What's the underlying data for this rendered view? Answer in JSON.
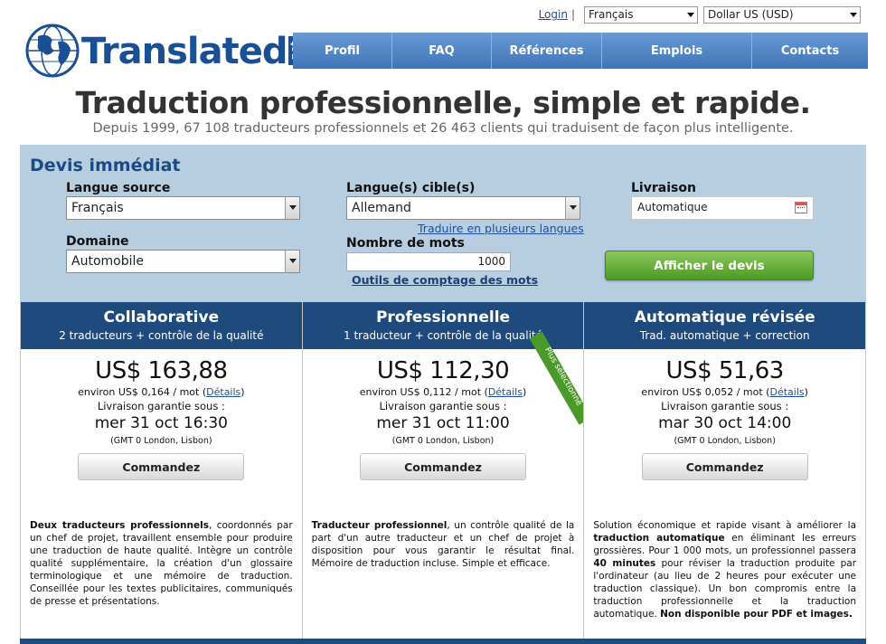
{
  "topbar": {
    "login": "Login",
    "separator": "|",
    "language": "Français",
    "currency": "Dollar US (USD)"
  },
  "logo": {
    "name": "Translated",
    "suffix": "net"
  },
  "nav": [
    "Profil",
    "FAQ",
    "Références",
    "Emplois",
    "Contacts"
  ],
  "headline": "Traduction professionnelle, simple et rapide.",
  "subline": "Depuis 1999, 67 108 traducteurs professionnels et 26 463 clients qui traduisent de façon plus intelligente.",
  "quote": {
    "title": "Devis immédiat",
    "source_label": "Langue source",
    "source_value": "Français",
    "target_label": "Langue(s) cible(s)",
    "target_value": "Allemand",
    "multi_link": "Traduire en plusieurs langues",
    "delivery_label": "Livraison",
    "delivery_value": "Automatique",
    "domain_label": "Domaine",
    "domain_value": "Automobile",
    "words_label": "Nombre de mots",
    "words_value": "1000",
    "count_link": "Outils de comptage des mots",
    "submit": "Afficher le devis"
  },
  "plans": [
    {
      "title": "Collaborative",
      "subtitle": "2 traducteurs + contrôle de la qualité",
      "price": "US$ 163,88",
      "per_word": "environ US$ 0,164 / mot (",
      "details": "Détails",
      "per_close": ")",
      "guarantee": "Livraison garantie sous :",
      "date": "mer 31 oct 16:30",
      "tz": "(GMT 0 London, Lisbon)",
      "order": "Commandez",
      "desc_bold": "Deux traducteurs professionnels",
      "desc": ", coordonnés par un chef de projet, travaillent ensemble pour produire une traduction de haute qualité. Intègre un contrôle qualité supplémentaire, la création d'un glossaire terminologique et une mémoire de traduction. Conseillée pour les textes publicitaires, communiqués de presse et présentations."
    },
    {
      "title": "Professionnelle",
      "subtitle": "1 traducteur + contrôle de la qualité",
      "price": "US$ 112,30",
      "per_word": "environ US$ 0,112 / mot (",
      "details": "Détails",
      "per_close": ")",
      "guarantee": "Livraison garantie sous :",
      "date": "mer 31 oct 11:00",
      "tz": "(GMT 0 London, Lisbon)",
      "order": "Commandez",
      "ribbon": "Plus sélectionné",
      "desc_bold": "Traducteur professionnel",
      "desc": ", un contrôle qualité de la part d'un autre traducteur et un chef de projet à disposition pour vous garantir le résultat final. Mémoire de traduction incluse. Simple et efficace."
    },
    {
      "title": "Automatique révisée",
      "subtitle": "Trad. automatique + correction",
      "price": "US$ 51,63",
      "per_word": "environ US$ 0,052 / mot (",
      "details": "Détails",
      "per_close": ")",
      "guarantee": "Livraison garantie sous :",
      "date": "mar 30 oct 14:00",
      "tz": "(GMT 0 London, Lisbon)",
      "order": "Commandez",
      "desc_a": "Solution économique et rapide visant à améliorer la ",
      "desc_b": "traduction automatique",
      "desc_c": " en éliminant les erreurs grossières. Pour 1 000 mots, un professionnel passera ",
      "desc_d": "40 minutes",
      "desc_e": " pour réviser la traduction produite par l'ordinateur (au lieu de 2 heures pour exécuter une traduction classique). Un bon compromis entre la traduction professionnelle et la traduction automatique. ",
      "desc_f": "Non disponible pour PDF et images."
    }
  ],
  "colors": {
    "brand": "#1b4f93",
    "panel": "#b7cde0",
    "header": "#1f4a7e",
    "green": "#4b9a22"
  }
}
